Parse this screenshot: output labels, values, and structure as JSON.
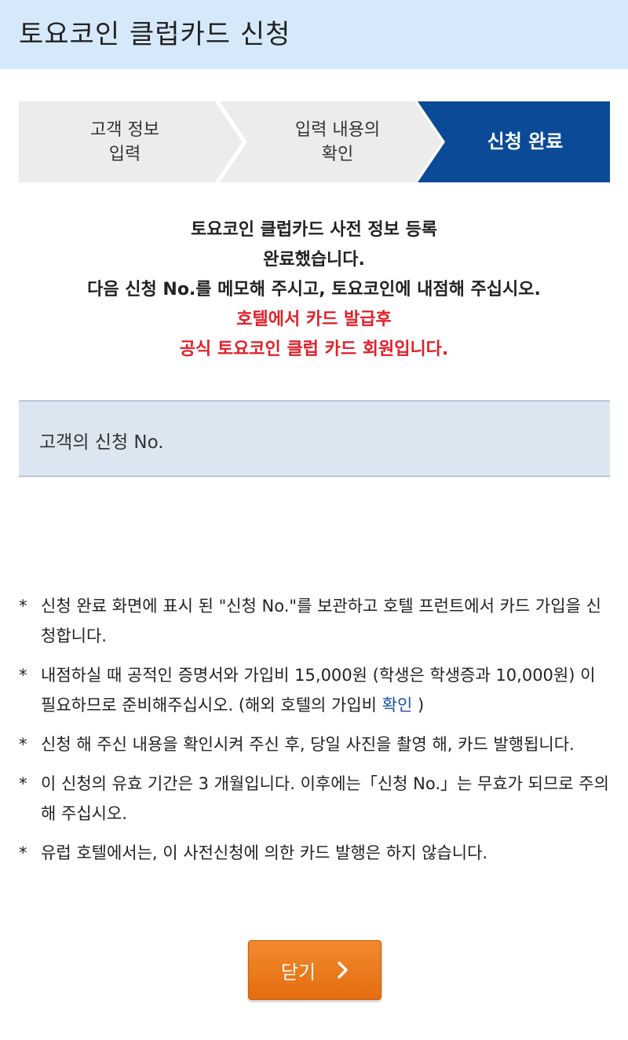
{
  "header": {
    "title": "토요코인 클럽카드 신청"
  },
  "steps": [
    {
      "line1": "고객 정보",
      "line2": "입력"
    },
    {
      "line1": "입력 내용의",
      "line2": "확인"
    },
    {
      "line1": "신청 완료",
      "line2": ""
    }
  ],
  "colors": {
    "step_inactive": "#ececec",
    "step_active": "#0b4a96",
    "accent_red": "#e0202a",
    "button": "#ee7b22"
  },
  "message": {
    "line1": "토요코인 클럽카드 사전 정보 등록",
    "line2": "완료했습니다.",
    "line3": "다음 신청 No.를 메모해 주시고, 토요코인에 내점해 주십시오.",
    "red_line1": "호텔에서 카드 발급후",
    "red_line2": "공식 토요코인 클럽 카드 회원입니다."
  },
  "application": {
    "label": "고객의 신청 No."
  },
  "notes": {
    "bullet": "*",
    "n1": "신청 완료 화면에 표시 된 \"신청 No.\"를 보관하고 호텔 프런트에서 카드 가입을 신청합니다.",
    "n2_before": "내점하실 때 공적인 증명서와 가입비 15,000원 (학생은 학생증과 10,000원) 이 필요하므로 준비해주십시오. (해외 호텔의 가입비 ",
    "n2_link": "확인",
    "n2_after": " )",
    "n3": "신청 해 주신 내용을 확인시켜 주신 후, 당일 사진을 촬영 해, 카드 발행됩니다.",
    "n4": "이 신청의 유효 기간은 3 개월입니다. 이후에는「신청 No.」는 무효가 되므로 주의해 주십시오.",
    "n5": "유럽 호텔에서는, 이 사전신청에 의한 카드 발행은 하지 않습니다."
  },
  "close_button": {
    "label": "닫기",
    "icon": "chevron-right-icon"
  }
}
